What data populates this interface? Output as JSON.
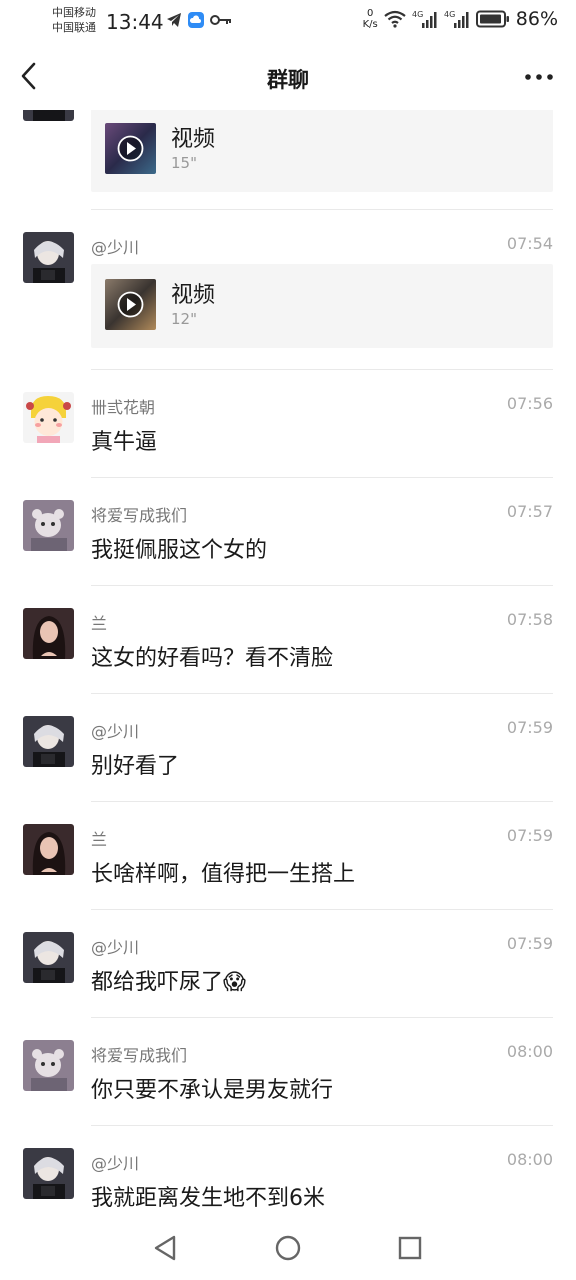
{
  "status_bar": {
    "carrier_1": "中国移动",
    "carrier_2": "中国联通",
    "time": "13:44",
    "net_speed_value": "0",
    "net_speed_unit": "K/s",
    "signal_1_label": "4G",
    "signal_2_label": "4G",
    "battery": "86%"
  },
  "header": {
    "title": "群聊"
  },
  "messages": [
    {
      "type": "video",
      "sender": "",
      "time": "",
      "video_label": "视频",
      "duration": "15\""
    },
    {
      "type": "video",
      "sender": "@少川",
      "time": "07:54",
      "video_label": "视频",
      "duration": "12\""
    },
    {
      "type": "text",
      "sender": "卌弎花朝",
      "time": "07:56",
      "text": "真牛逼"
    },
    {
      "type": "text",
      "sender": "将爱写成我们",
      "time": "07:57",
      "text": "我挺佩服这个女的"
    },
    {
      "type": "text",
      "sender": "兰",
      "time": "07:58",
      "text": "这女的好看吗？看不清脸"
    },
    {
      "type": "text",
      "sender": "@少川",
      "time": "07:59",
      "text": "别好看了"
    },
    {
      "type": "text",
      "sender": "兰",
      "time": "07:59",
      "text": "长啥样啊，值得把一生搭上"
    },
    {
      "type": "text",
      "sender": "@少川",
      "time": "07:59",
      "text": "都给我吓尿了😱"
    },
    {
      "type": "text",
      "sender": "将爱写成我们",
      "time": "08:00",
      "text": "你只要不承认是男友就行"
    },
    {
      "type": "text",
      "sender": "@少川",
      "time": "08:00",
      "text": "我就距离发生地不到6米"
    }
  ],
  "icons": {
    "back": "back-arrow-icon",
    "more": "more-dots-icon",
    "play": "play-icon",
    "nav_back": "nav-back-triangle-icon",
    "nav_home": "nav-home-circle-icon",
    "nav_recent": "nav-recent-square-icon"
  },
  "colors": {
    "background": "#ffffff",
    "card": "#f5f5f5",
    "sender": "#777777",
    "time": "#aaaaaa"
  }
}
